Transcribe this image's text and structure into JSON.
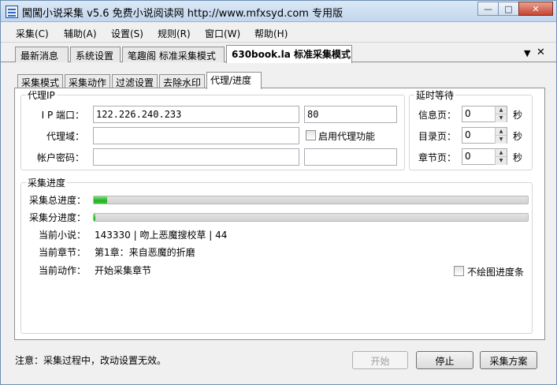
{
  "title": "闖闖小说采集 v5.6 免费小说阅读网 http://www.mfxsyd.com 专用版",
  "window_controls": {
    "minimize": "—",
    "maximize": "□",
    "close": "✕"
  },
  "menu": [
    "采集(C)",
    "辅助(A)",
    "设置(S)",
    "规则(R)",
    "窗口(W)",
    "帮助(H)"
  ],
  "doc_tabs": [
    "最新消息",
    "系统设置",
    "笔趣阁 标准采集模式",
    "630book.la 标准采集模式"
  ],
  "doc_tabs_controls": {
    "dropdown": "▼",
    "close": "✕"
  },
  "sub_tabs": [
    "采集模式",
    "采集动作",
    "过滤设置",
    "去除水印",
    "代理/进度"
  ],
  "proxy": {
    "legend": "代理IP",
    "ip_port_label": "I P 端口：",
    "ip_value": "122.226.240.233",
    "port_value": "80",
    "domain_label": "代理域：",
    "domain_value": "",
    "enable_label": "启用代理功能",
    "account_label": "帐户密码：",
    "account_value": "",
    "password_value": ""
  },
  "delay": {
    "legend": "延时等待",
    "unit": "秒",
    "rows": [
      {
        "label": "信息页：",
        "value": "0"
      },
      {
        "label": "目录页：",
        "value": "0"
      },
      {
        "label": "章节页：",
        "value": "0"
      }
    ]
  },
  "progress": {
    "legend": "采集进度",
    "total_label": "采集总进度：",
    "total_fraction": 0.03,
    "sub_label": "采集分进度：",
    "sub_fraction": 0.0,
    "novel_label": "当前小说：",
    "novel_value": "143330 | 吻上恶魔搜校草 | 44",
    "chapter_label": "当前章节：",
    "chapter_value": "第1章：来自恶魔的折磨",
    "action_label": "当前动作：",
    "action_value": "开始采集章节",
    "no_draw_label": "不绘图进度条"
  },
  "footer": {
    "note": "注意：采集过程中，改动设置无效。",
    "start": "开始",
    "stop": "停止",
    "plan": "采集方案"
  }
}
